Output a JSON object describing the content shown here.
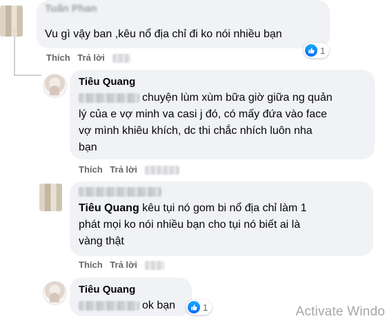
{
  "comments": [
    {
      "id": "c1",
      "author": "Tuấn Phan",
      "text": "Vu gì vậy ban ,kêu nổ địa chỉ đi ko nói nhiều bạn",
      "actions": {
        "like": "Thích",
        "reply": "Trả lời"
      },
      "reaction_count": "1"
    },
    {
      "id": "c2",
      "author": "Tiêu Quang",
      "lines": [
        "chuyện lùm xùm bữa giờ giữa ng quản",
        "lý của e vợ minh va casi j đó, có mấy đứa vào face",
        "vợ mình khiêu khích, dc thi chắc nhích luôn nha",
        "bạn"
      ],
      "actions": {
        "like": "Thích",
        "reply": "Trả lời"
      }
    },
    {
      "id": "c3",
      "mention": "Tiêu Quang",
      "lines": [
        "kêu tụi nó gom bi nổ địa chỉ làm 1",
        "phát mọi ko nói nhiều bạn cho tụi nó biết ai là",
        "vàng thật"
      ],
      "actions": {
        "like": "Thích",
        "reply": "Trả lời"
      }
    },
    {
      "id": "c4",
      "author": "Tiêu Quang",
      "text": "ok bạn",
      "reaction_count": "1"
    }
  ],
  "watermark": "Activate Windo"
}
